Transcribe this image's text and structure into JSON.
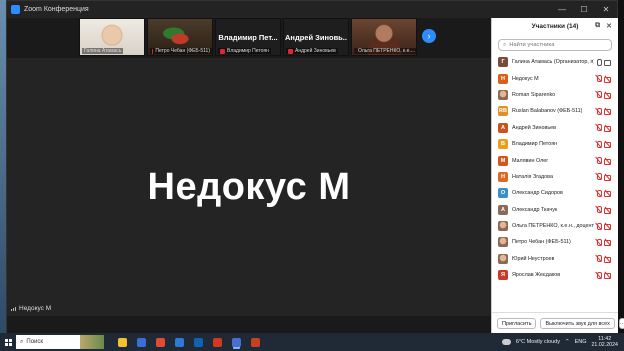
{
  "window": {
    "title": "Zoom Конференция",
    "minimize": "—",
    "maximize": "☐",
    "close": "✕"
  },
  "gallery": [
    {
      "name": "Галина Атамась",
      "type": "photo1",
      "muted": false
    },
    {
      "name": "Петро Чебан (ФЕБ-511)",
      "type": "photo2",
      "muted": true
    },
    {
      "name": "Владимир Петоян",
      "type": "nameonly",
      "big": "Владимир Пет...",
      "muted": true
    },
    {
      "name": "Андрей Зиновьев",
      "type": "nameonly",
      "big": "Андрей Зиновь...",
      "muted": true
    },
    {
      "name": "Ольга ПЕТРЕНКО, к.е....",
      "type": "photo3",
      "muted": true
    }
  ],
  "next_arrow": "›",
  "speaker": {
    "name": "Недокус М",
    "tag": "Недокус М"
  },
  "panel": {
    "title": "Участники (14)",
    "search_placeholder": "Найти участника",
    "participants": [
      {
        "initial": "Г",
        "color": "#7a4a3a",
        "name": "Галина Атамась (Организатор, я)",
        "mic": "on",
        "cam": "on"
      },
      {
        "initial": "Н",
        "color": "#d9601a",
        "name": "Недокус М",
        "mic": "off",
        "cam": "off"
      },
      {
        "initial": "",
        "color": "",
        "photo": true,
        "name": "Roman Siparenko",
        "mic": "off",
        "cam": "off"
      },
      {
        "initial": "RB",
        "color": "#e0902a",
        "name": "Ruslan Balabanov (ФЕБ-511)",
        "mic": "off",
        "cam": "off"
      },
      {
        "initial": "А",
        "color": "#c8531e",
        "name": "Андрей Зиновьев",
        "mic": "off",
        "cam": "off"
      },
      {
        "initial": "В",
        "color": "#e8a018",
        "name": "Владимир Петоян",
        "mic": "off",
        "cam": "off"
      },
      {
        "initial": "М",
        "color": "#d2551f",
        "name": "Малявин Олег",
        "mic": "off",
        "cam": "off"
      },
      {
        "initial": "Н",
        "color": "#db6a22",
        "name": "Наталія Згадова",
        "mic": "off",
        "cam": "off"
      },
      {
        "initial": "О",
        "color": "#3b8fc9",
        "name": "Олександр Сидоров",
        "mic": "off",
        "cam": "off"
      },
      {
        "initial": "А",
        "color": "#8a6a5a",
        "name": "Олександр Ткачук",
        "mic": "off",
        "cam": "off"
      },
      {
        "initial": "",
        "color": "",
        "photo": true,
        "name": "Ольга ПЕТРЕНКО, к.е.н., доцент к...",
        "mic": "off",
        "cam": "off"
      },
      {
        "initial": "",
        "color": "",
        "photo": true,
        "name": "Петро Чебан (ФЕБ-511)",
        "mic": "off",
        "cam": "off"
      },
      {
        "initial": "",
        "color": "",
        "photo": true,
        "name": "Юрий Неустроев",
        "mic": "off",
        "cam": "off"
      },
      {
        "initial": "Я",
        "color": "#c93a2a",
        "name": "Ярослав Жеєдаков",
        "mic": "off",
        "cam": "off"
      }
    ],
    "invite_label": "Пригласить",
    "mute_all_label": "Выключить звук для всех",
    "more_label": "···"
  },
  "taskbar": {
    "search_label": "Поиск",
    "weather": "6°C  Mostly cloudy",
    "lang": "ENG",
    "time": "11:42",
    "date": "21.02.2024",
    "apps": [
      "#f2c230",
      "#3a6fd8",
      "#e24a33",
      "#2e7bd6",
      "#0d63b5",
      "#d2381e",
      "#4b6fd0",
      "#c8401e"
    ]
  }
}
